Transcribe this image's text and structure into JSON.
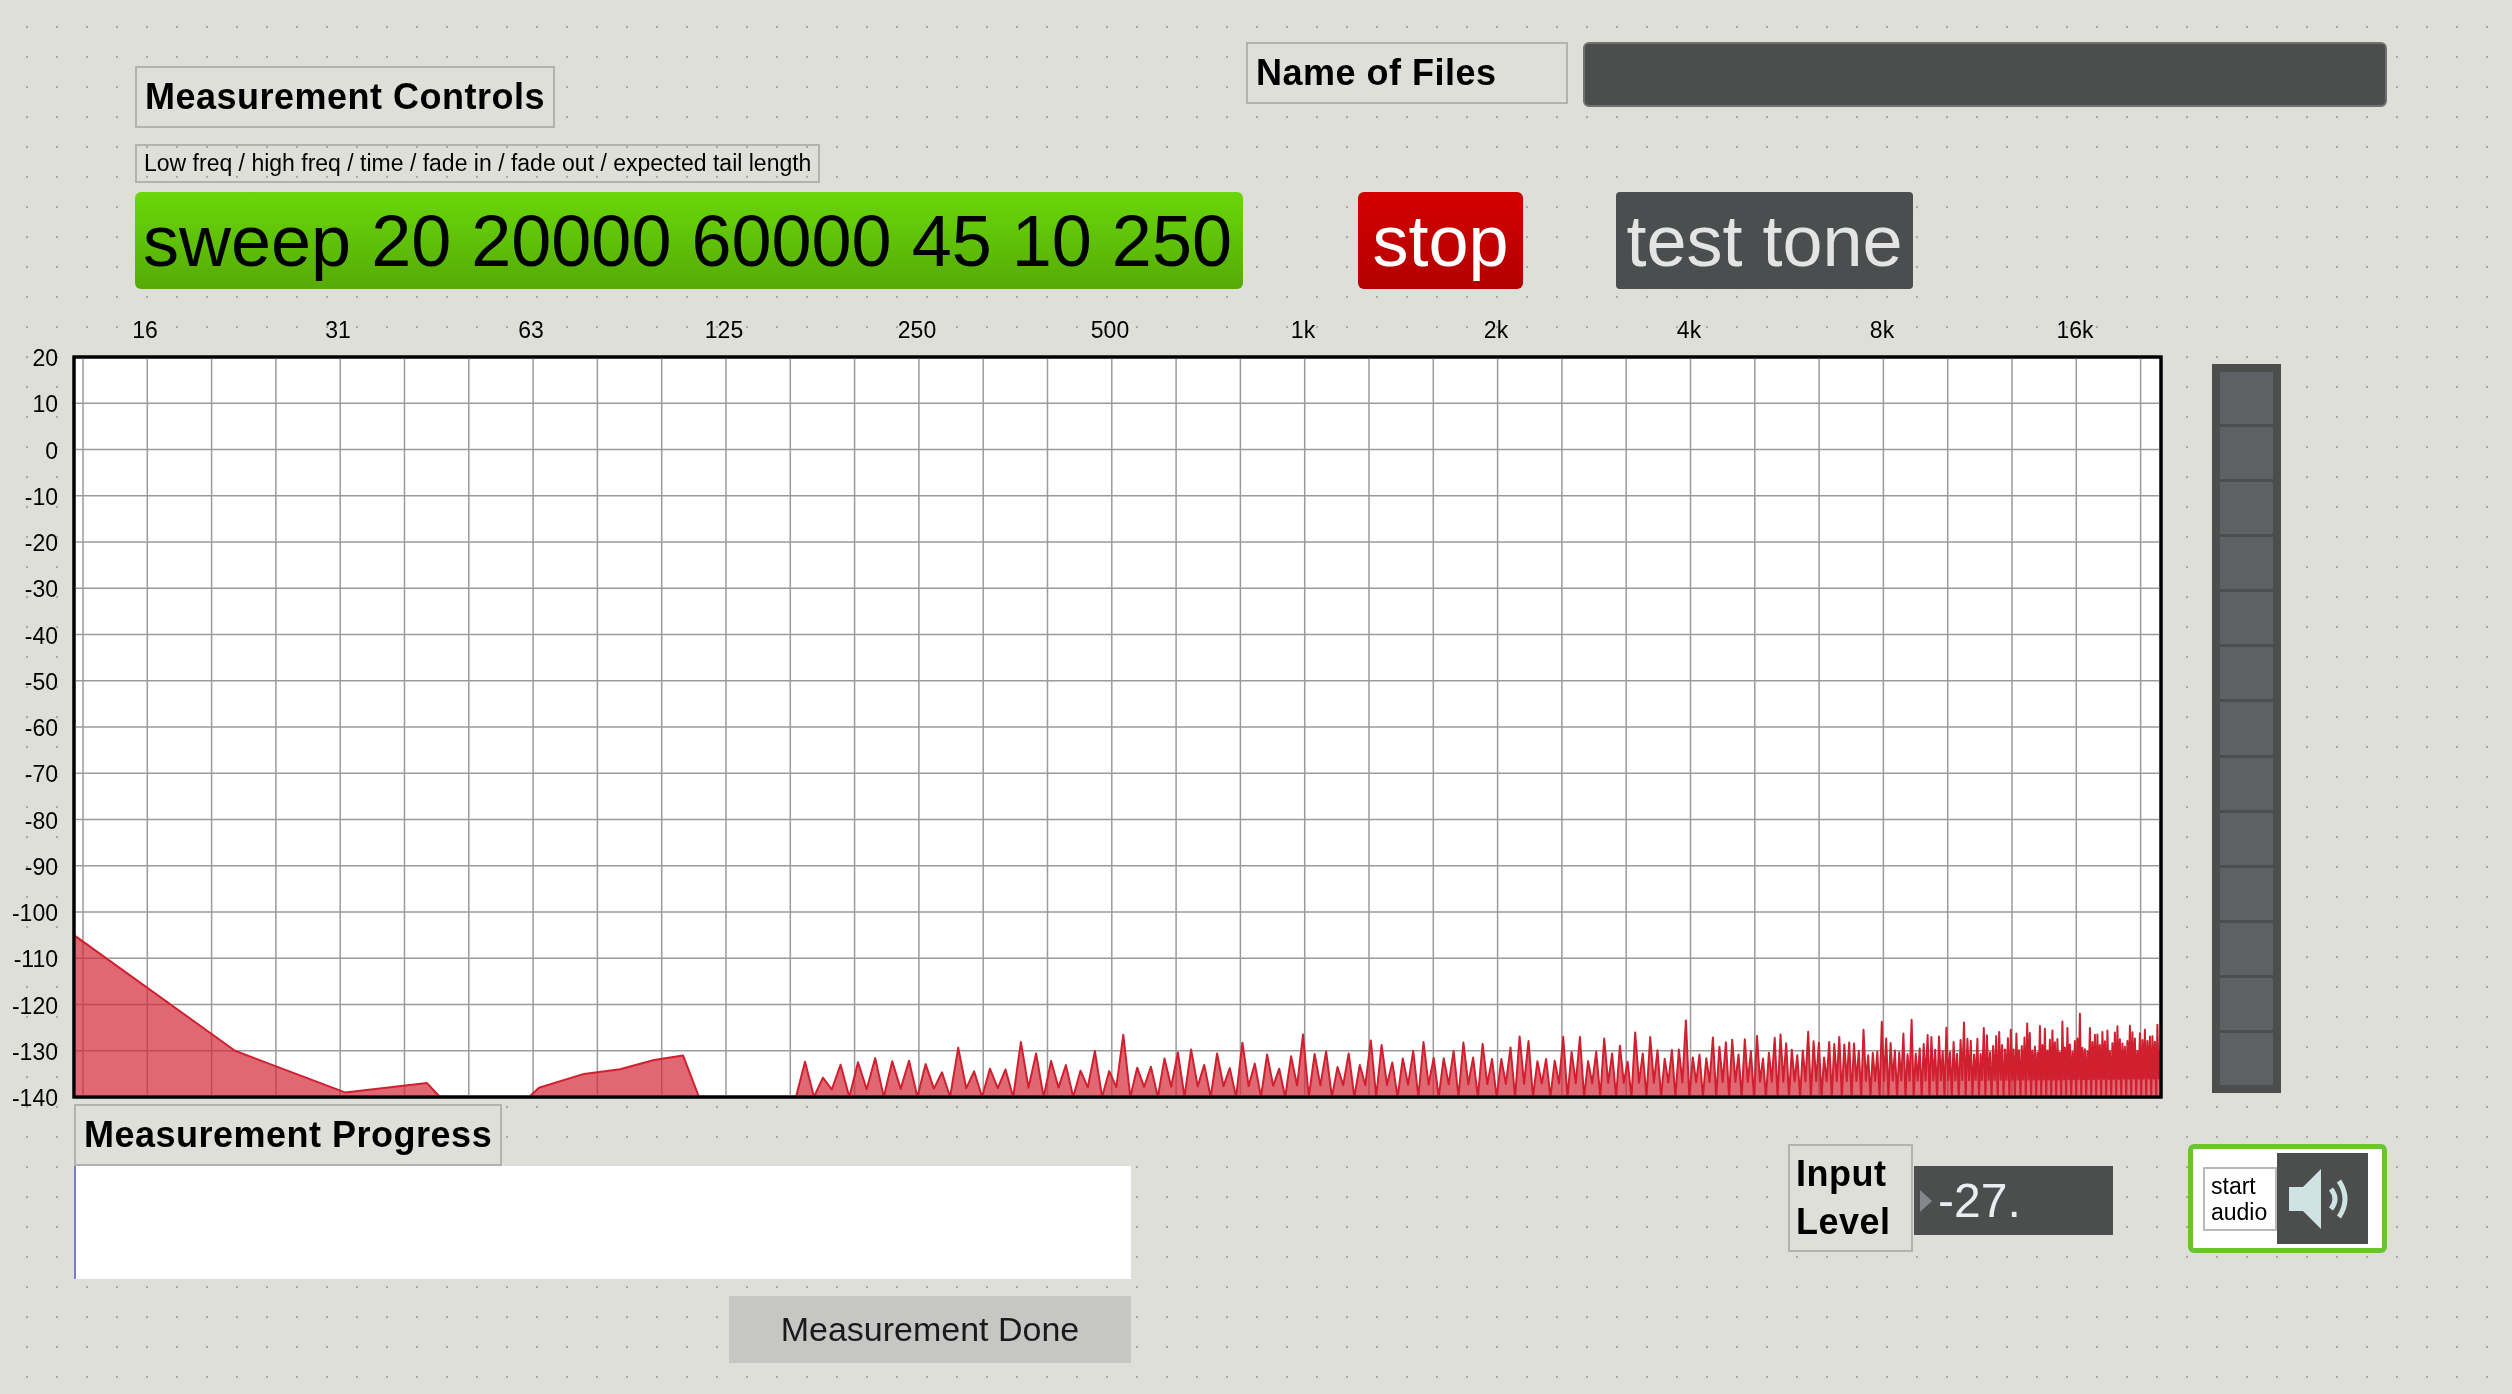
{
  "controls": {
    "title": "Measurement Controls",
    "hint": "Low freq / high freq / time / fade in / fade out / expected tail length",
    "sweep_message": "sweep 20 20000 60000 45 10 250"
  },
  "stop_button": "stop",
  "test_tone_button": "test tone",
  "files": {
    "label": "Name of Files"
  },
  "spectrum": {
    "x_ticks": [
      "16",
      "31",
      "63",
      "125",
      "250",
      "500",
      "1k",
      "2k",
      "4k",
      "8k",
      "16k"
    ],
    "y_ticks": [
      "20",
      "10",
      "0",
      "-10",
      "-20",
      "-30",
      "-40",
      "-50",
      "-60",
      "-70",
      "-80",
      "-90",
      "-100",
      "-110",
      "-120",
      "-130",
      "-140"
    ]
  },
  "meter": {
    "level": 0
  },
  "progress": {
    "title": "Measurement Progress",
    "level": 0
  },
  "done_button": "Measurement Done",
  "input_level": {
    "label": "Input Level",
    "value": "-27."
  },
  "audio": {
    "label": "start audio"
  }
}
